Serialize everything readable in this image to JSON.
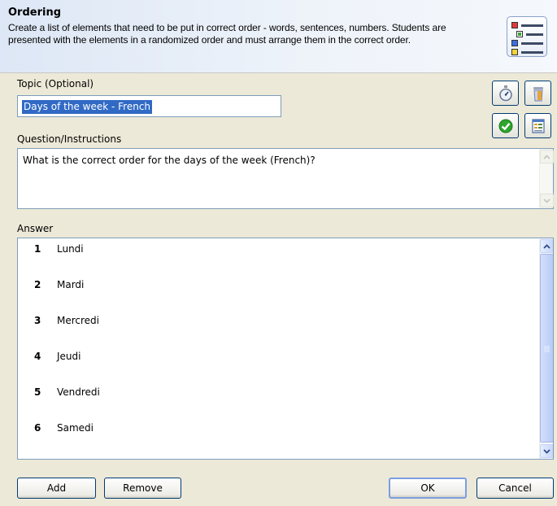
{
  "header": {
    "title": "Ordering",
    "description": "Create a list of elements that need to be put in correct order - words, sentences, numbers. Students are presented with the elements in a randomized order and must arrange them in the correct order."
  },
  "topic": {
    "label": "Topic (Optional)",
    "value": "Days of the week - French"
  },
  "question": {
    "label": "Question/Instructions",
    "value": "What is the correct order for the days of the week (French)?"
  },
  "answer": {
    "label": "Answer",
    "items": [
      {
        "num": "1",
        "text": "Lundi"
      },
      {
        "num": "2",
        "text": "Mardi"
      },
      {
        "num": "3",
        "text": "Mercredi"
      },
      {
        "num": "4",
        "text": "Jeudi"
      },
      {
        "num": "5",
        "text": "Vendredi"
      },
      {
        "num": "6",
        "text": "Samedi"
      }
    ]
  },
  "buttons": {
    "add": "Add",
    "remove": "Remove",
    "ok": "OK",
    "cancel": "Cancel"
  },
  "tool_icons": [
    "stopwatch-icon",
    "trash-icon",
    "checkmark-icon",
    "properties-icon"
  ],
  "colors": {
    "selection": "#316ac5",
    "input_border": "#7f9db9",
    "dialog_bg": "#ece9d8"
  }
}
